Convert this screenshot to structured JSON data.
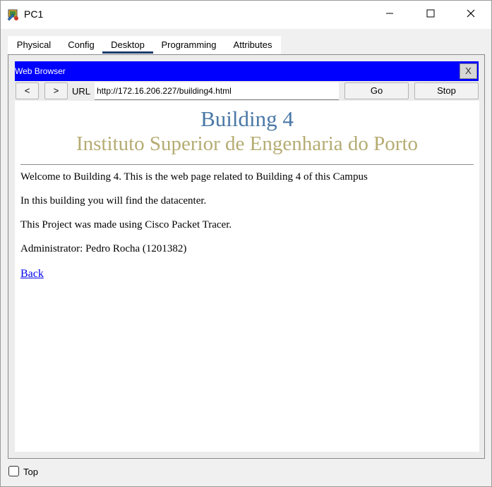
{
  "window": {
    "title": "PC1",
    "icon": "packet-tracer-pc-icon"
  },
  "tabs": [
    {
      "label": "Physical",
      "active": false
    },
    {
      "label": "Config",
      "active": false
    },
    {
      "label": "Desktop",
      "active": true
    },
    {
      "label": "Programming",
      "active": false
    },
    {
      "label": "Attributes",
      "active": false
    }
  ],
  "browser": {
    "title": "Web Browser",
    "close_label": "X",
    "back_label": "<",
    "forward_label": ">",
    "url_label": "URL",
    "url": "http://172.16.206.227/building4.html",
    "go_label": "Go",
    "stop_label": "Stop",
    "title_bar_color": "#0000ff"
  },
  "page": {
    "heading": "Building 4",
    "subheading": "Instituto Superior de Engenharia do Porto",
    "paragraphs": [
      "Welcome to Building 4. This is the web page related to Building 4 of this Campus",
      "In this building you will find the datacenter.",
      "This Project was made using Cisco Packet Tracer.",
      "Administrator: Pedro Rocha (1201382)"
    ],
    "link_label": "Back",
    "heading_color": "#4a78a6",
    "subheading_color": "#b5ac73"
  },
  "footer": {
    "top_label": "Top",
    "top_checked": false
  }
}
